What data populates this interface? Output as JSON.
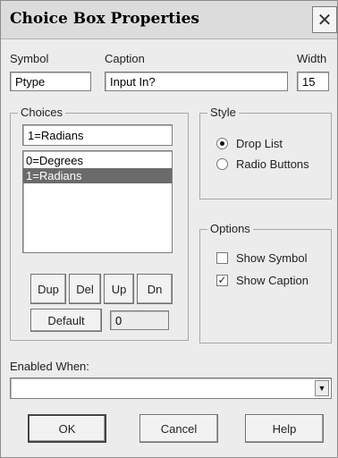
{
  "window": {
    "title": "Choice Box Properties",
    "close_glyph": "✕"
  },
  "fields": {
    "symbol_label": "Symbol",
    "symbol_value": "Ptype",
    "caption_label": "Caption",
    "caption_value": "Input In?",
    "width_label": "Width",
    "width_value": "15"
  },
  "choices": {
    "group_title": "Choices",
    "edit_value": "1=Radians",
    "items": [
      {
        "label": "0=Degrees",
        "selected": false
      },
      {
        "label": "1=Radians",
        "selected": true
      }
    ],
    "buttons": {
      "dup": "Dup",
      "del": "Del",
      "up": "Up",
      "dn": "Dn",
      "default": "Default"
    },
    "default_value": "0"
  },
  "style": {
    "group_title": "Style",
    "options": [
      {
        "label": "Drop List",
        "checked": true
      },
      {
        "label": "Radio Buttons",
        "checked": false
      }
    ]
  },
  "options": {
    "group_title": "Options",
    "items": [
      {
        "label": "Show Symbol",
        "checked": false
      },
      {
        "label": "Show Caption",
        "checked": true
      }
    ]
  },
  "enabled_when": {
    "label": "Enabled When:",
    "value": "",
    "arrow_glyph": "▼"
  },
  "footer": {
    "ok": "OK",
    "cancel": "Cancel",
    "help": "Help"
  }
}
